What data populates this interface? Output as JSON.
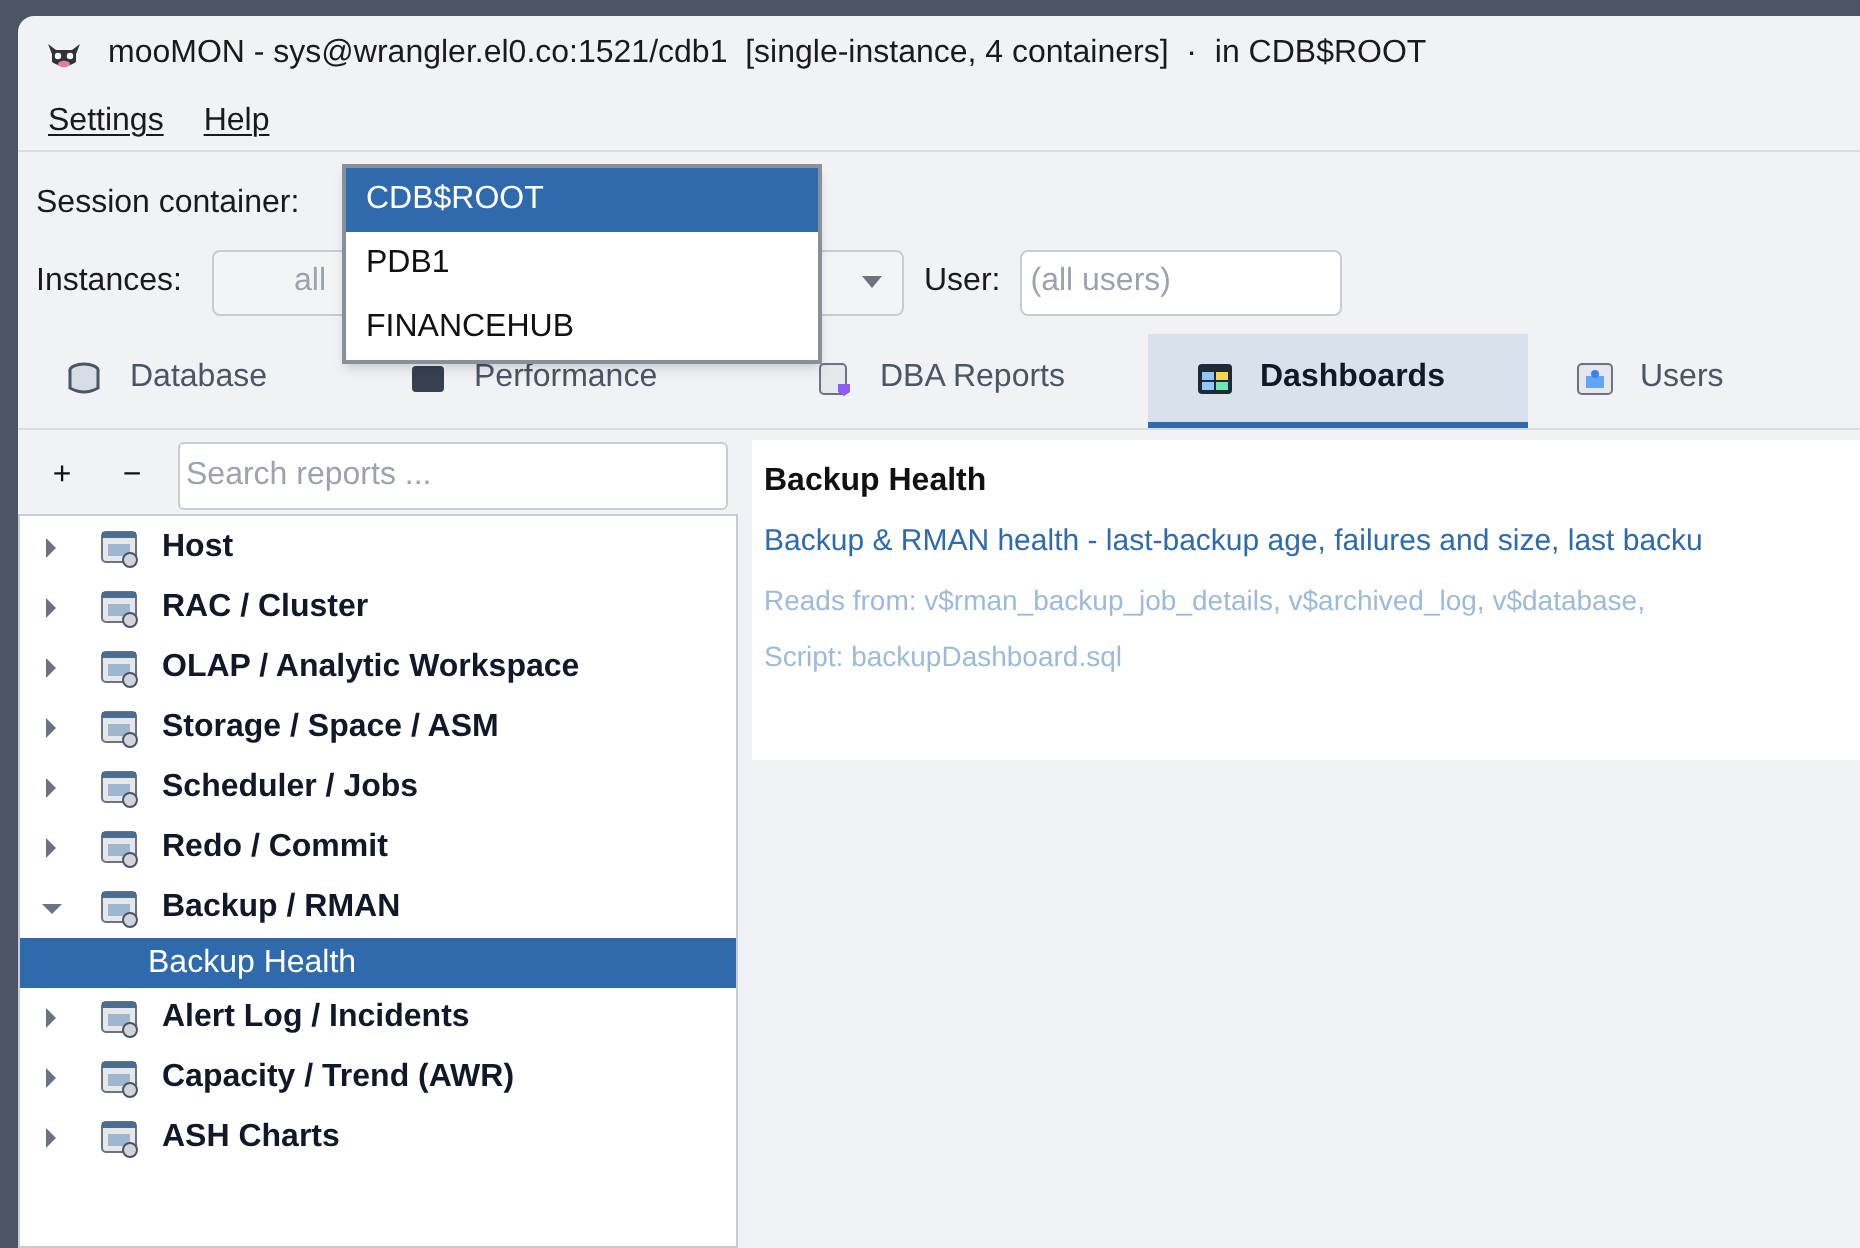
{
  "window": {
    "title": "mooMON - sys@wrangler.el0.co:1521/cdb1  [single-instance, 4 containers]  ·  in CDB$ROOT"
  },
  "menu": [
    {
      "label": "Settings"
    },
    {
      "label": "Help"
    }
  ],
  "session_container": {
    "label": "Session container:",
    "options": [
      {
        "label": "CDB$ROOT",
        "selected": true
      },
      {
        "label": "PDB1",
        "selected": false
      },
      {
        "label": "FINANCEHUB",
        "selected": false
      }
    ]
  },
  "instances": {
    "label": "Instances:",
    "value": "all"
  },
  "user": {
    "label": "User:",
    "placeholder": "(all users)"
  },
  "tabs": [
    {
      "label": "Database",
      "selected": false
    },
    {
      "label": "Performance",
      "selected": false
    },
    {
      "label": "DBA Reports",
      "selected": false
    },
    {
      "label": "Dashboards",
      "selected": true
    },
    {
      "label": "Users",
      "selected": false
    }
  ],
  "tree_toolbar": {
    "expand": "+",
    "collapse": "−",
    "search_placeholder": "Search reports ..."
  },
  "tree": [
    {
      "label": "Host",
      "expanded": false
    },
    {
      "label": "RAC / Cluster",
      "expanded": false
    },
    {
      "label": "OLAP / Analytic Workspace",
      "expanded": false
    },
    {
      "label": "Storage / Space / ASM",
      "expanded": false
    },
    {
      "label": "Scheduler / Jobs",
      "expanded": false
    },
    {
      "label": "Redo / Commit",
      "expanded": false
    },
    {
      "label": "Backup / RMAN",
      "expanded": true,
      "children": [
        {
          "label": "Backup Health",
          "selected": true
        }
      ]
    },
    {
      "label": "Alert Log / Incidents",
      "expanded": false
    },
    {
      "label": "Capacity / Trend (AWR)",
      "expanded": false
    },
    {
      "label": "ASH Charts",
      "expanded": false
    }
  ],
  "details": {
    "title": "Backup Health",
    "description": "Backup & RMAN health - last-backup age, failures and size, last backu",
    "reads_from": "Reads from: v$rman_backup_job_details, v$archived_log, v$database,",
    "script": "Script: backupDashboard.sql"
  }
}
